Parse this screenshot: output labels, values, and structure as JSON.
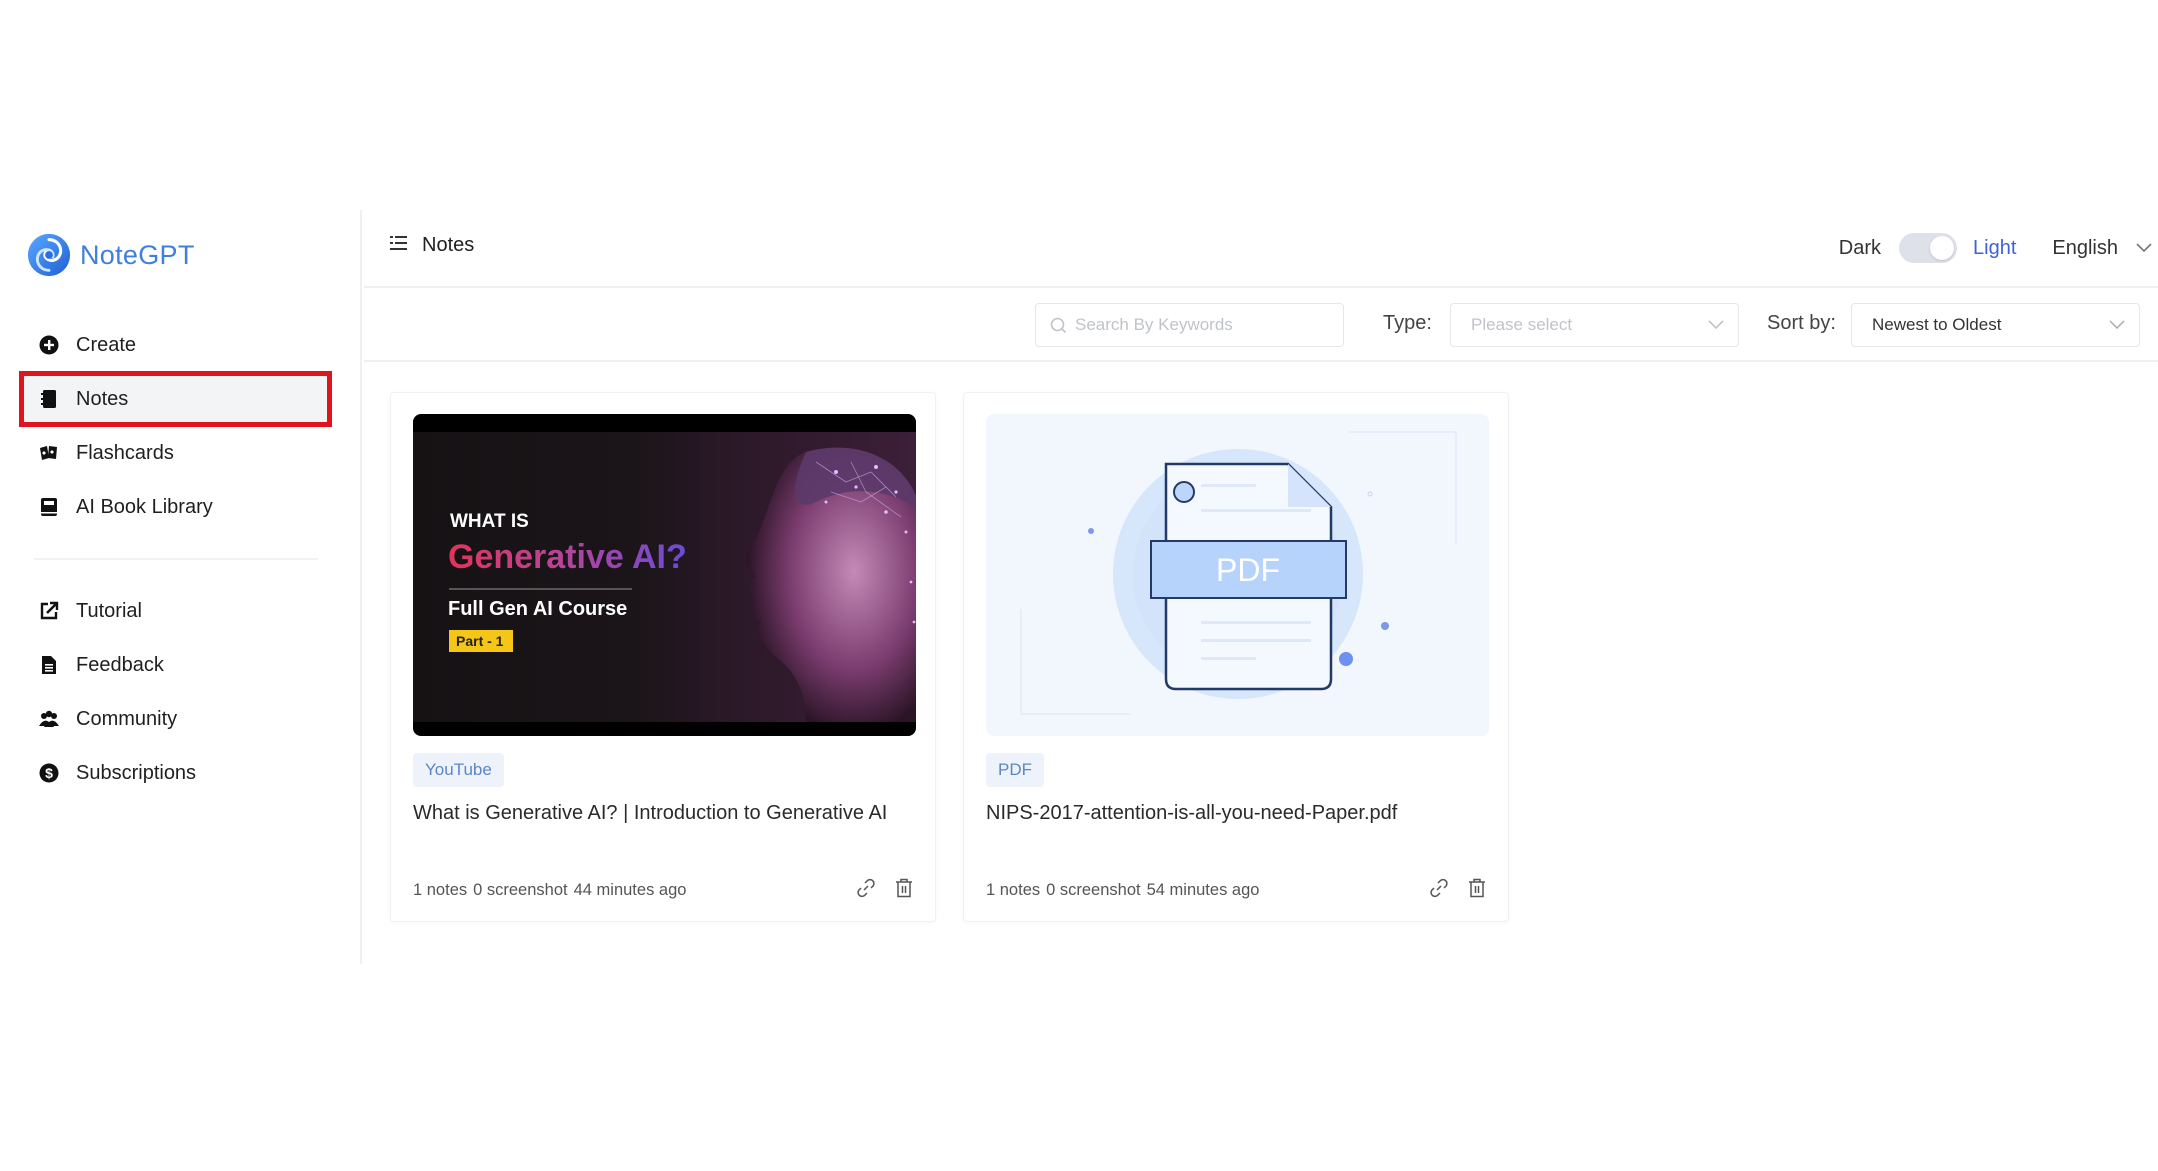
{
  "app": {
    "name": "NoteGPT",
    "brand_color": "#3f7fe0",
    "highlight_color": "#e0141e"
  },
  "sidebar": {
    "primary_items": [
      {
        "label": "Create",
        "icon": "plus-circle-icon",
        "active": false
      },
      {
        "label": "Notes",
        "icon": "notebook-icon",
        "active": true
      },
      {
        "label": "Flashcards",
        "icon": "flashcards-icon",
        "active": false
      },
      {
        "label": "AI Book Library",
        "icon": "book-icon",
        "active": false
      }
    ],
    "secondary_items": [
      {
        "label": "Tutorial",
        "icon": "external-link-icon"
      },
      {
        "label": "Feedback",
        "icon": "document-icon"
      },
      {
        "label": "Community",
        "icon": "users-icon"
      },
      {
        "label": "Subscriptions",
        "icon": "dollar-circle-icon"
      }
    ]
  },
  "header": {
    "title": "Notes",
    "theme": {
      "dark_label": "Dark",
      "light_label": "Light",
      "current": "Light"
    },
    "language": "English"
  },
  "filters": {
    "search_placeholder": "Search By Keywords",
    "search_value": "",
    "type_label": "Type:",
    "type_placeholder": "Please select",
    "sort_label": "Sort by:",
    "sort_value": "Newest to Oldest"
  },
  "notes": [
    {
      "tag": "YouTube",
      "title": "What is Generative AI? | Introduction to Generative AI",
      "notes_count": "1 notes",
      "screenshot_count": "0 screenshot",
      "time": "44 minutes ago",
      "thumbnail": {
        "line1": "WHAT IS",
        "line2": "Generative AI?",
        "line3": "Full Gen AI Course",
        "badge": "Part - 1"
      }
    },
    {
      "tag": "PDF",
      "title": "NIPS-2017-attention-is-all-you-need-Paper.pdf",
      "notes_count": "1 notes",
      "screenshot_count": "0 screenshot",
      "time": "54 minutes ago",
      "thumbnail": {
        "label": "PDF"
      }
    }
  ]
}
